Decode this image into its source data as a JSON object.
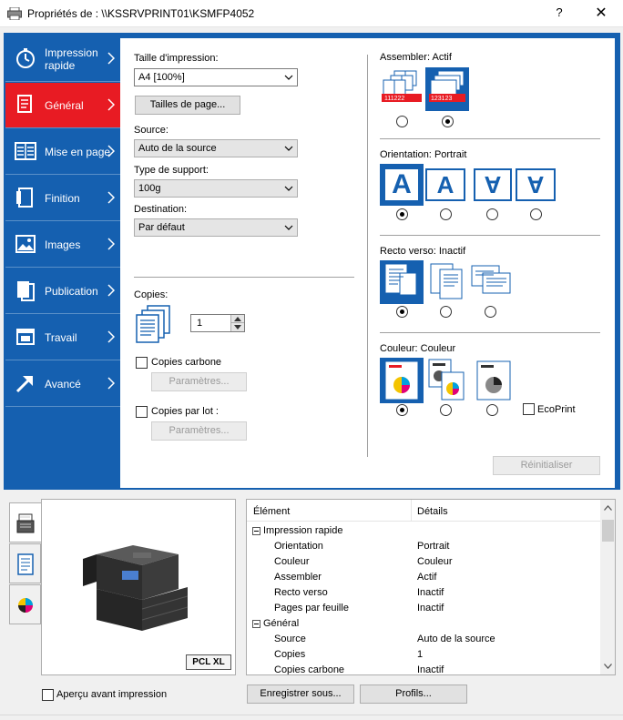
{
  "window": {
    "title": "Propriétés de : \\\\KSSRVPRINT01\\KSMFP4052",
    "help_glyph": "?",
    "close_glyph": "✕"
  },
  "nav": {
    "items": [
      {
        "label": "Impression rapide",
        "icon": "stopwatch-icon",
        "active": false
      },
      {
        "label": "Général",
        "icon": "document-icon",
        "active": true
      },
      {
        "label": "Mise en page",
        "icon": "layout-icon",
        "active": false
      },
      {
        "label": "Finition",
        "icon": "staple-icon",
        "active": false
      },
      {
        "label": "Images",
        "icon": "image-icon",
        "active": false
      },
      {
        "label": "Publication",
        "icon": "booklet-icon",
        "active": false
      },
      {
        "label": "Travail",
        "icon": "job-icon",
        "active": false
      },
      {
        "label": "Avancé",
        "icon": "arrow-icon",
        "active": false
      }
    ]
  },
  "general": {
    "print_size_label": "Taille d'impression:",
    "print_size_value": "A4  [100%]",
    "page_sizes_button": "Tailles de page...",
    "source_label": "Source:",
    "source_value": "Auto de la source",
    "media_type_label": "Type de support:",
    "media_type_value": "100g",
    "destination_label": "Destination:",
    "destination_value": "Par défaut",
    "copies_label": "Copies:",
    "copies_value": "1",
    "carbon_copies_label": "Copies carbone",
    "carbon_settings_button": "Paramètres...",
    "batch_copies_label": "Copies par lot :",
    "batch_settings_button": "Paramètres...",
    "reset_button": "Réinitialiser"
  },
  "right": {
    "collate_label": "Assembler:",
    "collate_value": "Actif",
    "orientation_label": "Orientation:",
    "orientation_value": "Portrait",
    "orientation_glyph": "A",
    "duplex_label": "Recto verso:",
    "duplex_value": "Inactif",
    "color_label": "Couleur:",
    "color_value": "Couleur",
    "ecoprint_label": "EcoPrint",
    "collate_icon_texts": [
      "111222",
      "123123"
    ]
  },
  "lower": {
    "pcl_badge": "PCL XL",
    "preview_checkbox_label": "Aperçu avant impression",
    "save_as_button": "Enregistrer sous...",
    "profiles_button": "Profils...",
    "table_header_element": "Élément",
    "table_header_details": "Détails",
    "rows": [
      {
        "k": "Impression rapide",
        "v": "",
        "group": true
      },
      {
        "k": "Orientation",
        "v": "Portrait",
        "group": false
      },
      {
        "k": "Couleur",
        "v": "Couleur",
        "group": false
      },
      {
        "k": "Assembler",
        "v": "Actif",
        "group": false
      },
      {
        "k": "Recto verso",
        "v": "Inactif",
        "group": false
      },
      {
        "k": "Pages par feuille",
        "v": "Inactif",
        "group": false
      },
      {
        "k": "Général",
        "v": "",
        "group": true
      },
      {
        "k": "Source",
        "v": "Auto de la source",
        "group": false
      },
      {
        "k": "Copies",
        "v": "1",
        "group": false
      },
      {
        "k": "Copies carbone",
        "v": "Inactif",
        "group": false
      }
    ]
  },
  "colors": {
    "nav_blue": "#1560b0",
    "active_red": "#e81b23"
  }
}
